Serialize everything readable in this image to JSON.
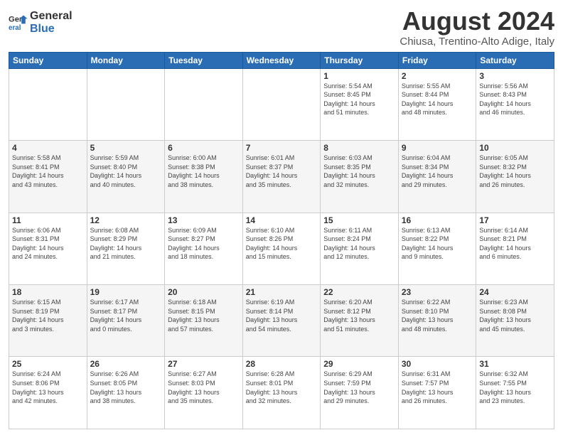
{
  "logo": {
    "line1": "General",
    "line2": "Blue"
  },
  "title": "August 2024",
  "location": "Chiusa, Trentino-Alto Adige, Italy",
  "days_header": [
    "Sunday",
    "Monday",
    "Tuesday",
    "Wednesday",
    "Thursday",
    "Friday",
    "Saturday"
  ],
  "weeks": [
    [
      {
        "day": "",
        "info": ""
      },
      {
        "day": "",
        "info": ""
      },
      {
        "day": "",
        "info": ""
      },
      {
        "day": "",
        "info": ""
      },
      {
        "day": "1",
        "info": "Sunrise: 5:54 AM\nSunset: 8:45 PM\nDaylight: 14 hours\nand 51 minutes."
      },
      {
        "day": "2",
        "info": "Sunrise: 5:55 AM\nSunset: 8:44 PM\nDaylight: 14 hours\nand 48 minutes."
      },
      {
        "day": "3",
        "info": "Sunrise: 5:56 AM\nSunset: 8:43 PM\nDaylight: 14 hours\nand 46 minutes."
      }
    ],
    [
      {
        "day": "4",
        "info": "Sunrise: 5:58 AM\nSunset: 8:41 PM\nDaylight: 14 hours\nand 43 minutes."
      },
      {
        "day": "5",
        "info": "Sunrise: 5:59 AM\nSunset: 8:40 PM\nDaylight: 14 hours\nand 40 minutes."
      },
      {
        "day": "6",
        "info": "Sunrise: 6:00 AM\nSunset: 8:38 PM\nDaylight: 14 hours\nand 38 minutes."
      },
      {
        "day": "7",
        "info": "Sunrise: 6:01 AM\nSunset: 8:37 PM\nDaylight: 14 hours\nand 35 minutes."
      },
      {
        "day": "8",
        "info": "Sunrise: 6:03 AM\nSunset: 8:35 PM\nDaylight: 14 hours\nand 32 minutes."
      },
      {
        "day": "9",
        "info": "Sunrise: 6:04 AM\nSunset: 8:34 PM\nDaylight: 14 hours\nand 29 minutes."
      },
      {
        "day": "10",
        "info": "Sunrise: 6:05 AM\nSunset: 8:32 PM\nDaylight: 14 hours\nand 26 minutes."
      }
    ],
    [
      {
        "day": "11",
        "info": "Sunrise: 6:06 AM\nSunset: 8:31 PM\nDaylight: 14 hours\nand 24 minutes."
      },
      {
        "day": "12",
        "info": "Sunrise: 6:08 AM\nSunset: 8:29 PM\nDaylight: 14 hours\nand 21 minutes."
      },
      {
        "day": "13",
        "info": "Sunrise: 6:09 AM\nSunset: 8:27 PM\nDaylight: 14 hours\nand 18 minutes."
      },
      {
        "day": "14",
        "info": "Sunrise: 6:10 AM\nSunset: 8:26 PM\nDaylight: 14 hours\nand 15 minutes."
      },
      {
        "day": "15",
        "info": "Sunrise: 6:11 AM\nSunset: 8:24 PM\nDaylight: 14 hours\nand 12 minutes."
      },
      {
        "day": "16",
        "info": "Sunrise: 6:13 AM\nSunset: 8:22 PM\nDaylight: 14 hours\nand 9 minutes."
      },
      {
        "day": "17",
        "info": "Sunrise: 6:14 AM\nSunset: 8:21 PM\nDaylight: 14 hours\nand 6 minutes."
      }
    ],
    [
      {
        "day": "18",
        "info": "Sunrise: 6:15 AM\nSunset: 8:19 PM\nDaylight: 14 hours\nand 3 minutes."
      },
      {
        "day": "19",
        "info": "Sunrise: 6:17 AM\nSunset: 8:17 PM\nDaylight: 14 hours\nand 0 minutes."
      },
      {
        "day": "20",
        "info": "Sunrise: 6:18 AM\nSunset: 8:15 PM\nDaylight: 13 hours\nand 57 minutes."
      },
      {
        "day": "21",
        "info": "Sunrise: 6:19 AM\nSunset: 8:14 PM\nDaylight: 13 hours\nand 54 minutes."
      },
      {
        "day": "22",
        "info": "Sunrise: 6:20 AM\nSunset: 8:12 PM\nDaylight: 13 hours\nand 51 minutes."
      },
      {
        "day": "23",
        "info": "Sunrise: 6:22 AM\nSunset: 8:10 PM\nDaylight: 13 hours\nand 48 minutes."
      },
      {
        "day": "24",
        "info": "Sunrise: 6:23 AM\nSunset: 8:08 PM\nDaylight: 13 hours\nand 45 minutes."
      }
    ],
    [
      {
        "day": "25",
        "info": "Sunrise: 6:24 AM\nSunset: 8:06 PM\nDaylight: 13 hours\nand 42 minutes."
      },
      {
        "day": "26",
        "info": "Sunrise: 6:26 AM\nSunset: 8:05 PM\nDaylight: 13 hours\nand 38 minutes."
      },
      {
        "day": "27",
        "info": "Sunrise: 6:27 AM\nSunset: 8:03 PM\nDaylight: 13 hours\nand 35 minutes."
      },
      {
        "day": "28",
        "info": "Sunrise: 6:28 AM\nSunset: 8:01 PM\nDaylight: 13 hours\nand 32 minutes."
      },
      {
        "day": "29",
        "info": "Sunrise: 6:29 AM\nSunset: 7:59 PM\nDaylight: 13 hours\nand 29 minutes."
      },
      {
        "day": "30",
        "info": "Sunrise: 6:31 AM\nSunset: 7:57 PM\nDaylight: 13 hours\nand 26 minutes."
      },
      {
        "day": "31",
        "info": "Sunrise: 6:32 AM\nSunset: 7:55 PM\nDaylight: 13 hours\nand 23 minutes."
      }
    ]
  ]
}
